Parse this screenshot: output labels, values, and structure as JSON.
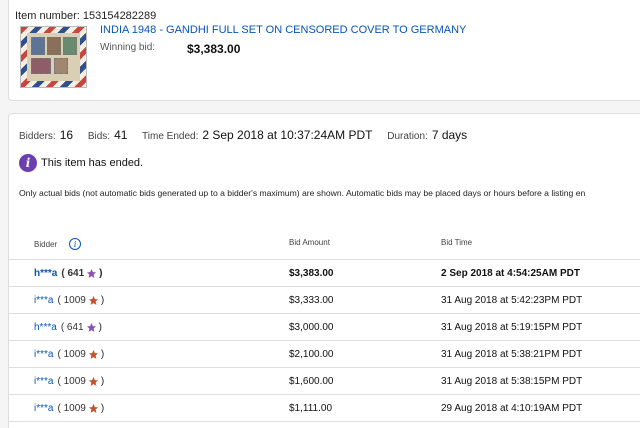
{
  "item": {
    "number_label": "Item number: 153154282289",
    "title": "INDIA 1948 - GANDHI FULL SET ON CENSORED COVER TO GERMANY",
    "winning_label": "Winning bid:",
    "winning_amount": "$3,383.00"
  },
  "stats": {
    "bidders_label": "Bidders:",
    "bidders_value": "16",
    "bids_label": "Bids:",
    "bids_value": "41",
    "time_label": "Time Ended:",
    "time_value": "2 Sep 2018 at 10:37:24AM PDT",
    "duration_label": "Duration:",
    "duration_value": "7 days"
  },
  "ended_message": "This item has ended.",
  "note": "Only actual bids (not automatic bids generated up to a bidder's maximum) are shown. Automatic bids may be placed days or hours before a listing en",
  "table": {
    "headers": {
      "bidder": "Bidder",
      "amount": "Bid Amount",
      "time": "Bid Time"
    },
    "rows": [
      {
        "bidder": "h***a",
        "score": "( 641",
        "close": ")",
        "star": "purple",
        "amount": "$3,383.00",
        "time": "2 Sep 2018 at 4:54:25AM PDT",
        "top": true
      },
      {
        "bidder": "i***a",
        "score": "( 1009",
        "close": ")",
        "star": "red",
        "amount": "$3,333.00",
        "time": "31 Aug 2018 at 5:42:23PM PDT"
      },
      {
        "bidder": "h***a",
        "score": "( 641",
        "close": ")",
        "star": "purple",
        "amount": "$3,000.00",
        "time": "31 Aug 2018 at 5:19:15PM PDT"
      },
      {
        "bidder": "i***a",
        "score": "( 1009",
        "close": ")",
        "star": "red",
        "amount": "$2,100.00",
        "time": "31 Aug 2018 at 5:38:21PM PDT"
      },
      {
        "bidder": "i***a",
        "score": "( 1009",
        "close": ")",
        "star": "red",
        "amount": "$1,600.00",
        "time": "31 Aug 2018 at 5:38:15PM PDT"
      },
      {
        "bidder": "i***a",
        "score": "( 1009",
        "close": ")",
        "star": "red",
        "amount": "$1,111.00",
        "time": "29 Aug 2018 at 4:10:19AM PDT"
      }
    ]
  },
  "colors": {
    "link": "#0654ba",
    "star_purple": "#8c4fb5",
    "star_red": "#c4532d",
    "info_badge": "#6c3fb0"
  }
}
